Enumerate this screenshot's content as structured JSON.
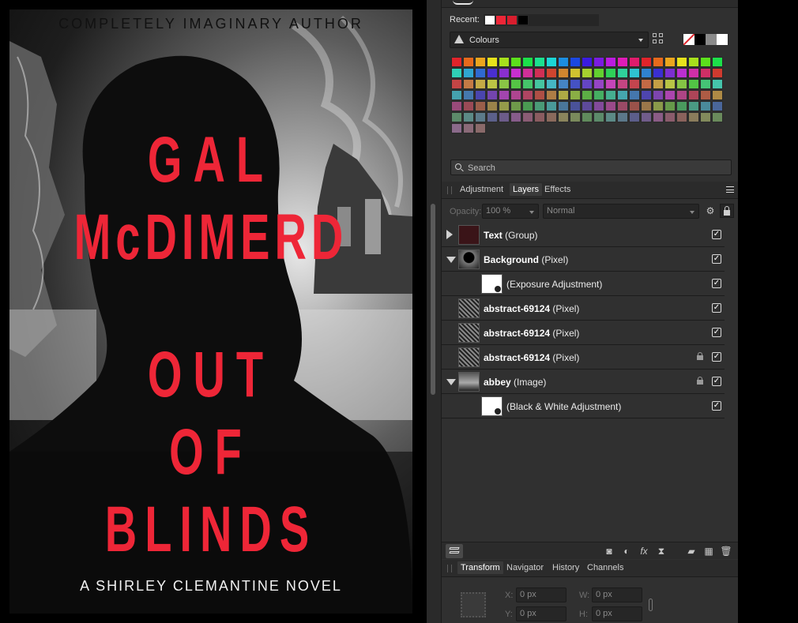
{
  "cover": {
    "author": "COMPLETELY IMAGINARY AUTHOR",
    "name_line1": "GAL",
    "name_line2": "McDIMERD",
    "title_line1": "OUT",
    "title_line2": "OF",
    "title_line3": "BLINDS",
    "subtitle": "A SHIRLEY CLEMANTINE NOVEL",
    "title_color": "#ee2637"
  },
  "swatches": {
    "recent_label": "Recent:",
    "recent_colors": [
      "#ffffff",
      "#ee2637",
      "#d81e2e",
      "#000000"
    ],
    "palette_name": "Colours",
    "palette_icon": "palette-icon",
    "row_colors": [
      [
        "#e0242b",
        "#e66a1c",
        "#eba51e",
        "#e7e21c",
        "#a7e01c",
        "#5ce01c",
        "#1ce04a",
        "#1ce08f",
        "#1cd6d6",
        "#1c8ee0",
        "#1c48e0",
        "#3a1ce0",
        "#7a1ce0",
        "#bb1ce0",
        "#e01cb8",
        "#e01c6c",
        "#e0242b",
        "#e66a1c",
        "#eba51e",
        "#e7e21c",
        "#a7e01c",
        "#5ce01c",
        "#1ce04a"
      ],
      [
        "#2fd0b6",
        "#2fa6d0",
        "#2f6ad0",
        "#4a2fd0",
        "#8a2fd0",
        "#c82fd0",
        "#d02f98",
        "#d02f55",
        "#d0452f",
        "#d0862f",
        "#d0c22f",
        "#a6d02f",
        "#62d02f",
        "#2fd058",
        "#2fd09a",
        "#2fc3d0",
        "#2f82d0",
        "#3a2fd0",
        "#7c2fd0",
        "#bb2fd0",
        "#d02fa8",
        "#d02f66",
        "#d03a2f"
      ],
      [
        "#c44545",
        "#c47a45",
        "#c4aa45",
        "#bcc445",
        "#8ac445",
        "#55c445",
        "#45c46a",
        "#45c4a0",
        "#45b6c4",
        "#4585c4",
        "#4552c4",
        "#6445c4",
        "#9545c4",
        "#c445b8",
        "#c44582",
        "#c4454e",
        "#c46a45",
        "#c49f45",
        "#b8c445",
        "#85c445",
        "#52c445",
        "#45c476",
        "#45c4ab"
      ],
      [
        "#45a2ae",
        "#4578ae",
        "#4a45ae",
        "#7445ae",
        "#a245ae",
        "#ae4590",
        "#ae4562",
        "#ae4f45",
        "#ae7d45",
        "#aeaa45",
        "#8aae45",
        "#5cae45",
        "#45ae62",
        "#45ae90",
        "#45a6ae",
        "#4577ae",
        "#4e45ae",
        "#7d45ae",
        "#ab45ae",
        "#ae4585",
        "#ae4558",
        "#ae5c45",
        "#ae8a45"
      ],
      [
        "#9a4a7a",
        "#9a4a56",
        "#9a5e4a",
        "#9a834a",
        "#949a4a",
        "#6f9a4a",
        "#4a9a52",
        "#4a9a77",
        "#4a9a9a",
        "#4a779a",
        "#4a529a",
        "#5e4a9a",
        "#834a9a",
        "#9a4a8a",
        "#9a4a66",
        "#9a524a",
        "#9a774a",
        "#8a9a4a",
        "#669a4a",
        "#4a9a5e",
        "#4a9a83",
        "#4a8a9a",
        "#4a669a"
      ],
      [
        "#5c8a6a",
        "#5c8a86",
        "#5c7a8a",
        "#5c608a",
        "#6c5c8a",
        "#865c8a",
        "#8a5c74",
        "#8a5c60",
        "#8a6a5c",
        "#8a845c",
        "#7a8a5c",
        "#608a5c",
        "#5c8a6a",
        "#5c8a86",
        "#5c788a",
        "#5c5e8a",
        "#705c8a",
        "#8a5c86",
        "#8a5c6c",
        "#8a625c",
        "#8a7c5c",
        "#828a5c",
        "#6a8a5c"
      ],
      [
        "#8a6a8a",
        "#8a6a78",
        "#8a6a6a"
      ]
    ],
    "search_placeholder": "Search"
  },
  "layers_panel": {
    "tabs": [
      "Adjustment",
      "Layers",
      "Effects"
    ],
    "active_tab": "Layers",
    "opacity_label": "Opacity:",
    "opacity_value": "100 %",
    "blend_mode": "Normal",
    "rows": [
      {
        "name": "Text",
        "kind": "(Group)",
        "expander": "right",
        "indent": 0,
        "thumb": "text-thumb",
        "lock": false,
        "visible": true
      },
      {
        "name": "Background",
        "kind": "(Pixel)",
        "expander": "down",
        "indent": 0,
        "thumb": "silhouette-thumb",
        "lock": false,
        "visible": true
      },
      {
        "name": "",
        "kind": "(Exposure Adjustment)",
        "expander": "none",
        "indent": 1,
        "thumb": "adjustment-thumb",
        "lock": false,
        "visible": true
      },
      {
        "name": "abstract-69124",
        "kind": "(Pixel)",
        "expander": "none",
        "indent": 0,
        "thumb": "abstract-thumb",
        "lock": false,
        "visible": true
      },
      {
        "name": "abstract-69124",
        "kind": "(Pixel)",
        "expander": "none",
        "indent": 0,
        "thumb": "abstract-thumb",
        "lock": false,
        "visible": true
      },
      {
        "name": "abstract-69124",
        "kind": "(Pixel)",
        "expander": "none",
        "indent": 0,
        "thumb": "abstract-thumb",
        "lock": true,
        "visible": true
      },
      {
        "name": "abbey",
        "kind": "(Image)",
        "expander": "down",
        "indent": 0,
        "thumb": "abbey-thumb",
        "lock": true,
        "visible": true
      },
      {
        "name": "",
        "kind": "(Black & White Adjustment)",
        "expander": "none",
        "indent": 1,
        "thumb": "adjustment-thumb",
        "lock": false,
        "visible": true
      }
    ]
  },
  "transform_panel": {
    "tabs": [
      "Transform",
      "Navigator",
      "History",
      "Channels"
    ],
    "active_tab": "Transform",
    "x_label": "X:",
    "x_value": "0 px",
    "y_label": "Y:",
    "y_value": "0 px",
    "w_label": "W:",
    "w_value": "0 px",
    "h_label": "H:",
    "h_value": "0 px"
  }
}
